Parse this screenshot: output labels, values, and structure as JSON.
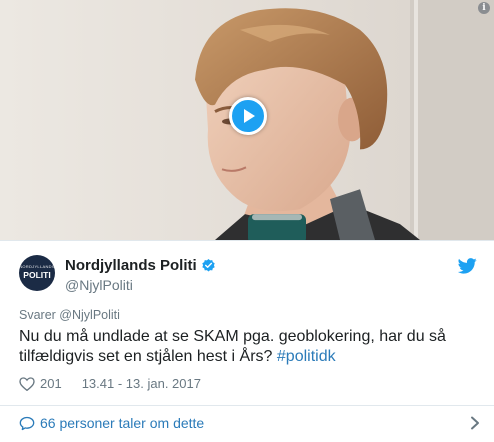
{
  "media": {
    "play_icon": "play-icon",
    "info_icon": "info-icon",
    "info_glyph": "i"
  },
  "author": {
    "avatar_text_top": "NORDJYLLANDS",
    "avatar_text_logo": "POLITI",
    "display_name": "Nordjyllands Politi",
    "handle": "@NjylPoliti",
    "verified_icon": "verified-badge-icon",
    "brand_icon": "twitter-bird-icon"
  },
  "tweet": {
    "reply_prefix": "Svarer ",
    "reply_handle": "@NjylPoliti",
    "text": "Nu du må undlade at se SKAM pga. geoblokering, har du så tilfældigvis set en stjålen hest i Års? ",
    "hashtag": "#politidk",
    "like_count": "201",
    "timestamp": "13.41 - 13. jan. 2017"
  },
  "footer": {
    "conversation_label": "66 personer taler om dette"
  },
  "colors": {
    "brand_blue": "#1da1f2",
    "link_blue": "#2b7bb9",
    "muted": "#697882"
  }
}
